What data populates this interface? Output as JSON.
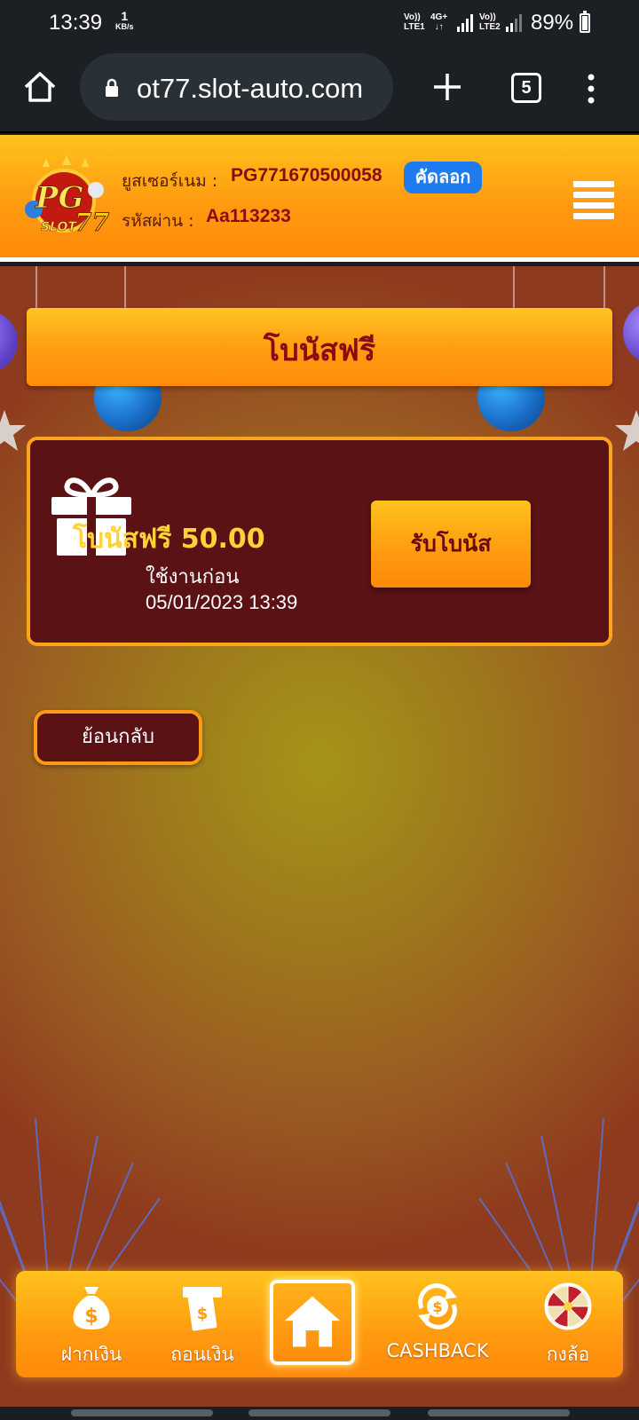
{
  "status_bar": {
    "time": "13:39",
    "speed_value": "1",
    "speed_unit": "KB/s",
    "sim1_top": "Vo))",
    "sim1_bottom": "LTE1",
    "network_type": "4G+",
    "sim2_top": "Vo))",
    "sim2_bottom": "LTE2",
    "battery": "89%"
  },
  "browser": {
    "url": "ot77.slot-auto.com",
    "tab_count": "5",
    "icons": [
      "home-icon",
      "lock-icon",
      "plus-icon",
      "tabs-icon",
      "more-vert-icon"
    ]
  },
  "header": {
    "logo_text": "PG SLOT77",
    "username_label": "ยูสเซอร์เนม :",
    "username_value": "PG771670500058",
    "copy_label": "คัดลอก",
    "password_label": "รหัสผ่าน :",
    "password_value": "Aa113233",
    "colors": {
      "header_top": "#ffc21c",
      "header_bottom": "#ff8a0a",
      "copy_button": "#1e7cf0",
      "value_text": "#8c0b12"
    }
  },
  "main": {
    "title": "โบนัสฟรี",
    "bonus": {
      "amount_label": "โบนัสฟรี 50.00",
      "use_before_label": "ใช้งานก่อน",
      "expiry": "05/01/2023 13:39",
      "claim_label": "รับโบนัส"
    },
    "back_label": "ย้อนกลับ",
    "colors": {
      "card_bg": "#5a1214",
      "card_border": "#ffa21c",
      "amount_text": "#ffd23a"
    }
  },
  "bottom_nav": {
    "items": [
      {
        "label": "ฝากเงิน",
        "icon": "money-bag-icon"
      },
      {
        "label": "ถอนเงิน",
        "icon": "withdraw-cash-icon"
      },
      {
        "label": "",
        "icon": "home-icon"
      },
      {
        "label": "CASHBACK",
        "icon": "cashback-coin-icon"
      },
      {
        "label": "กงล้อ",
        "icon": "wheel-icon"
      }
    ]
  }
}
